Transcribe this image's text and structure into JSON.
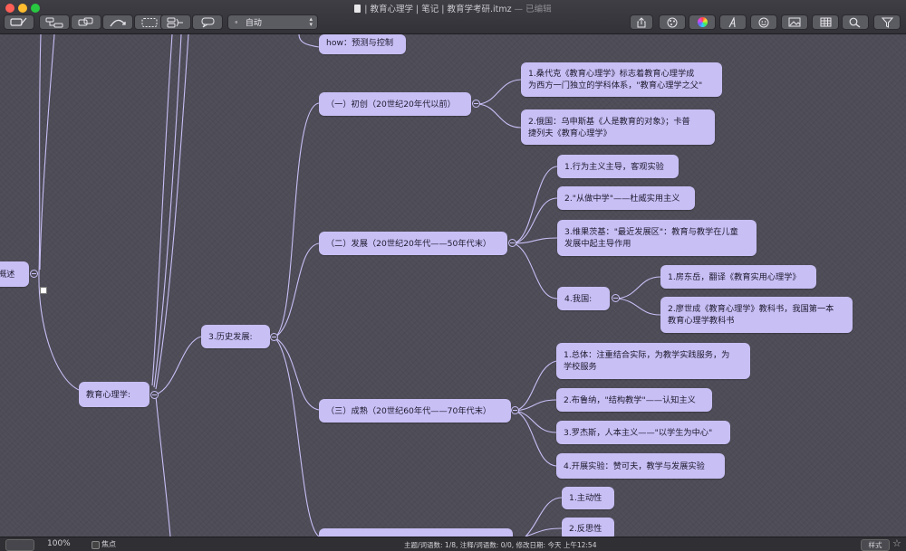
{
  "window": {
    "title": "| 教育心理学 | 笔记 | 教育学考研.itmz",
    "edited": "— 已编辑",
    "colors": {
      "close": "#fe5f57",
      "minimize": "#febc2e",
      "zoom": "#28c840"
    }
  },
  "toolbar": {
    "left_icons": [
      "topic-icon",
      "subtopic-icon",
      "relationship-icon",
      "callout-arrow-icon",
      "boundary-icon",
      "summary-icon",
      "callout-icon"
    ],
    "layout_select": {
      "value": "自动"
    },
    "right_icons": [
      "share-icon",
      "theme-icon",
      "color-wheel-icon",
      "font-icon",
      "emoji-icon",
      "image-icon",
      "table-icon",
      "search-icon",
      "filter-icon"
    ]
  },
  "mindmap": {
    "node_color": "#c8bff5",
    "link_color": "#c8bff5",
    "nodes": {
      "overview": "概述",
      "root": "教育心理学:",
      "history": "3.历史发展:",
      "top_partial": "how：预测与控制",
      "p1": "（一）初创（20世纪20年代以前）",
      "p1_c1": "1.桑代克《教育心理学》标志着教育心理学成\n为西方一门独立的学科体系，\"教育心理学之父\"",
      "p1_c2": "2.俄国：乌申斯基《人是教育的对象》；卡普\n捷列夫《教育心理学》",
      "p2": "（二）发展（20世纪20年代——50年代末）",
      "p2_c1": "1.行为主义主导，客观实验",
      "p2_c2": "2.\"从做中学\"——杜威实用主义",
      "p2_c3": "3.维果茨基：\"最近发展区\"：教育与教学在儿童\n发展中起主导作用",
      "p2_c4": "4.我国:",
      "p2_c4_c1": "1.房东岳，翻译《教育实用心理学》",
      "p2_c4_c2": "2.廖世成《教育心理学》教科书，我国第一本\n教育心理学教科书",
      "p3": "（三）成熟（20世纪60年代——70年代末）",
      "p3_c1": "1.总体：注重结合实际，为教学实践服务，为\n学校服务",
      "p3_c2": "2.布鲁纳，\"结构教学\"——认知主义",
      "p3_c3": "3.罗杰斯，人本主义——\"以学生为中心\"",
      "p3_c4": "4.开展实验：赞可夫，教学与发展实验",
      "p4_c1": "1.主动性",
      "p4_c2": "2.反思性"
    }
  },
  "statusbar": {
    "zoom": "100%",
    "focus_label": "焦点",
    "info": "主题/词语数: 1/8, 注释/词语数: 0/0, 修改日期: 今天 上午12:54",
    "style_button": "样式"
  }
}
